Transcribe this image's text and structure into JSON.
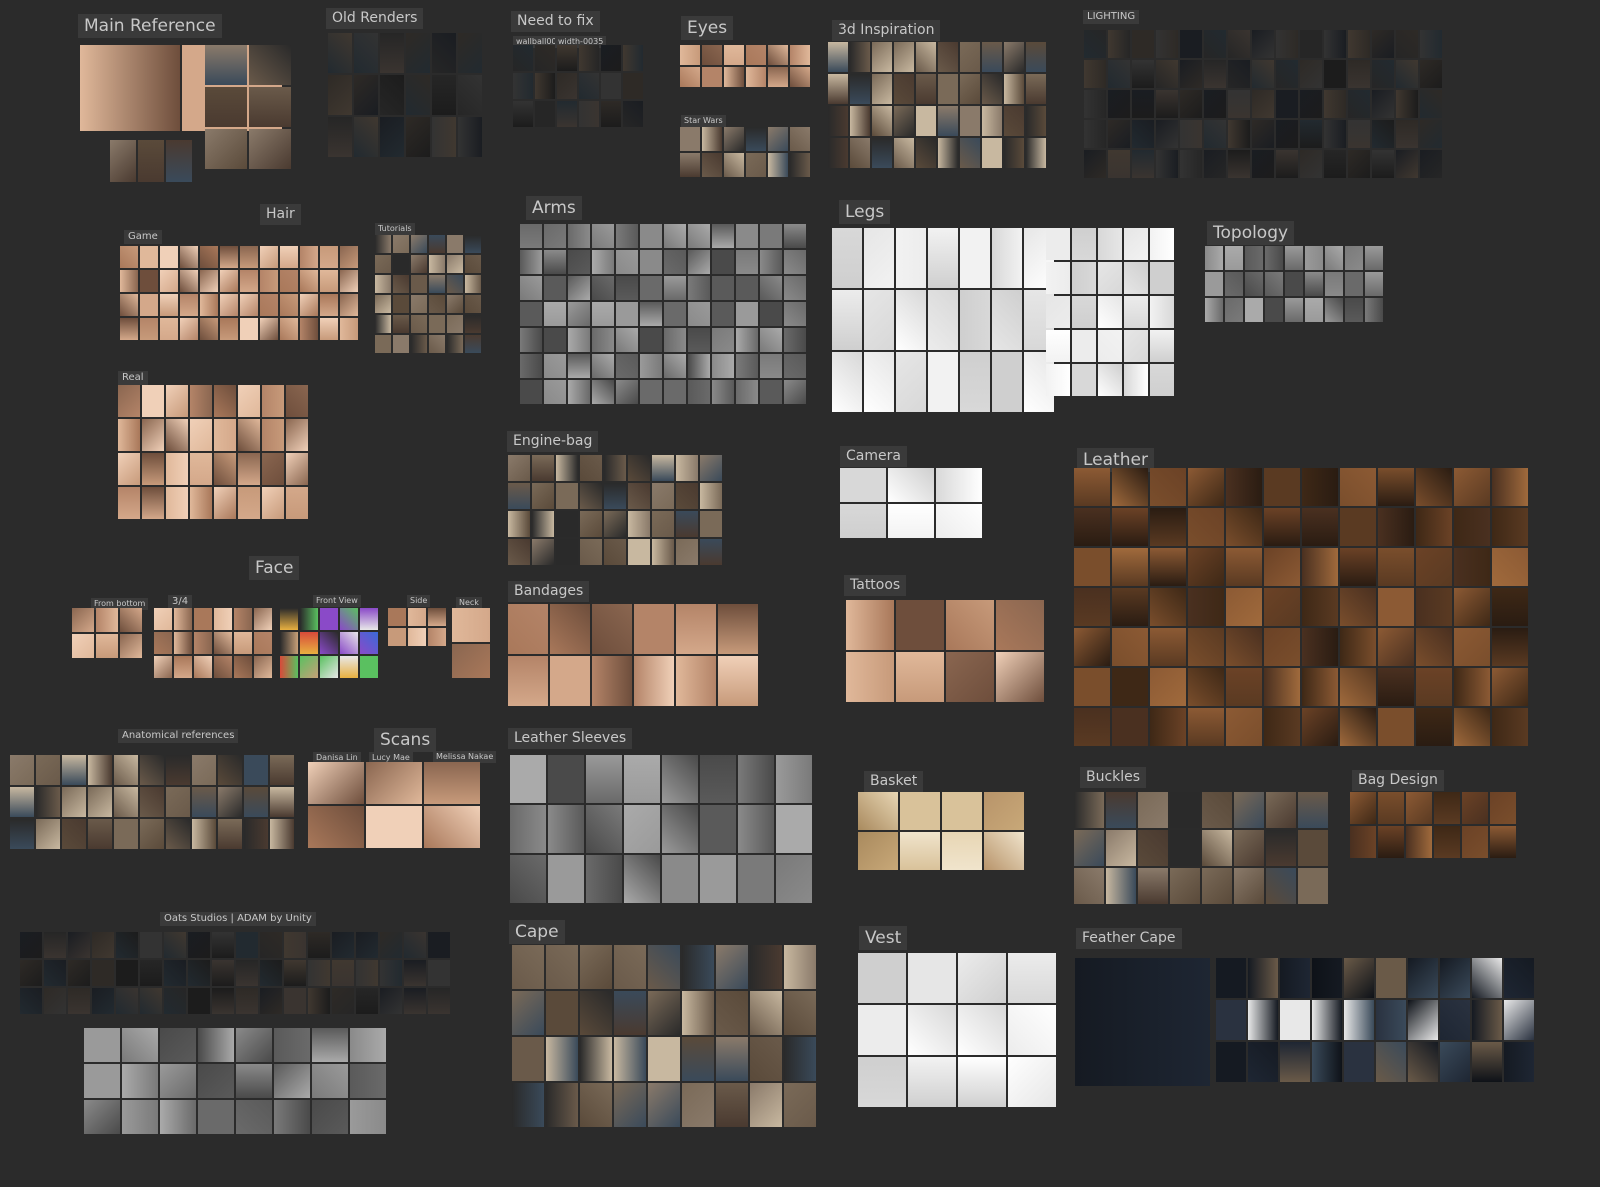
{
  "board": {
    "background": "#2b2b2b",
    "label_bg": "#3a3a3a",
    "label_color": "#c8c8c8",
    "groups": [
      {
        "key": "main_reference",
        "title": "Main Reference"
      },
      {
        "key": "old_renders",
        "title": "Old Renders"
      },
      {
        "key": "need_to_fix",
        "title": "Need to fix",
        "tiny_labels": [
          "wallball0017",
          "width-0035"
        ]
      },
      {
        "key": "eyes",
        "title": "Eyes"
      },
      {
        "key": "star_wars",
        "title": "Star Wars"
      },
      {
        "key": "inspiration_3d",
        "title": "3d Inspiration"
      },
      {
        "key": "lighting",
        "title": "LIGHTING"
      },
      {
        "key": "hair",
        "title": "Hair"
      },
      {
        "key": "game",
        "title": "Game"
      },
      {
        "key": "tutorials",
        "title": "Tutorials"
      },
      {
        "key": "real",
        "title": "Real"
      },
      {
        "key": "arms",
        "title": "Arms"
      },
      {
        "key": "legs",
        "title": "Legs"
      },
      {
        "key": "topology",
        "title": "Topology"
      },
      {
        "key": "engine_bag",
        "title": "Engine-bag"
      },
      {
        "key": "camera",
        "title": "Camera"
      },
      {
        "key": "leather",
        "title": "Leather"
      },
      {
        "key": "bandages",
        "title": "Bandages"
      },
      {
        "key": "tattoos",
        "title": "Tattoos"
      },
      {
        "key": "face",
        "title": "Face"
      },
      {
        "key": "from_bottom",
        "title": "From bottom"
      },
      {
        "key": "three_quarter",
        "title": "3/4"
      },
      {
        "key": "front_view",
        "title": "Front View"
      },
      {
        "key": "side",
        "title": "Side"
      },
      {
        "key": "neck",
        "title": "Neck"
      },
      {
        "key": "anatomical",
        "title": "Anatomical references"
      },
      {
        "key": "scans",
        "title": "Scans"
      },
      {
        "key": "danisa_lin",
        "title": "Danisa Lin"
      },
      {
        "key": "lucy_mae",
        "title": "Lucy Mae"
      },
      {
        "key": "melissa_nakae",
        "title": "Melissa Nakae"
      },
      {
        "key": "leather_sleeves",
        "title": "Leather Sleeves"
      },
      {
        "key": "basket",
        "title": "Basket"
      },
      {
        "key": "buckles",
        "title": "Buckles"
      },
      {
        "key": "bag_design",
        "title": "Bag Design"
      },
      {
        "key": "oats_studios",
        "title": "Oats Studios | ADAM by Unity"
      },
      {
        "key": "cape",
        "title": "Cape"
      },
      {
        "key": "vest",
        "title": "Vest"
      },
      {
        "key": "feather_cape",
        "title": "Feather Cape"
      }
    ],
    "palettes": {
      "dark": [
        "#1c1c1c",
        "#262626",
        "#333",
        "#2e2a26",
        "#3a3430",
        "#222a30",
        "#403830",
        "#1a1d22"
      ],
      "skin": [
        "#c79a7a",
        "#a9785a",
        "#e0b89a",
        "#8a6650",
        "#d4a88a",
        "#6e4e3c",
        "#b48468",
        "#f0d0b8"
      ],
      "leather": [
        "#5a3a22",
        "#7a4e2c",
        "#3e2816",
        "#8c5a34",
        "#2a1c12",
        "#a06a3c",
        "#4a3020",
        "#6b4226"
      ],
      "white": [
        "#f2f2f2",
        "#e6e6e6",
        "#d8d8d8",
        "#ffffff",
        "#cfcfcf",
        "#ececec"
      ],
      "gray": [
        "#6a6a6a",
        "#8a8a8a",
        "#5a5a5a",
        "#9a9a9a",
        "#7a7a7a",
        "#4a4a4a",
        "#aaaaaa"
      ],
      "wicker": [
        "#d9c29a",
        "#c8a878",
        "#e8d6b4",
        "#b8946a",
        "#f0e4cc",
        "#a98a5e"
      ],
      "feather": [
        "#151a22",
        "#1e2633",
        "#0e1218",
        "#2a3240",
        "#3a4a5a",
        "#6a5a48",
        "#e8e8e8"
      ],
      "mix": [
        "#4a3a30",
        "#6a5a4a",
        "#2a2a2a",
        "#8a7a6a",
        "#3a4a5a",
        "#5a4a3a",
        "#c8b8a0",
        "#7a6a58"
      ],
      "bright": [
        "#e8b040",
        "#3a6ad8",
        "#d84a3a",
        "#5ac060",
        "#e8e8e8",
        "#8a4ac8",
        "#2a2a2a",
        "#c8a078"
      ]
    }
  }
}
